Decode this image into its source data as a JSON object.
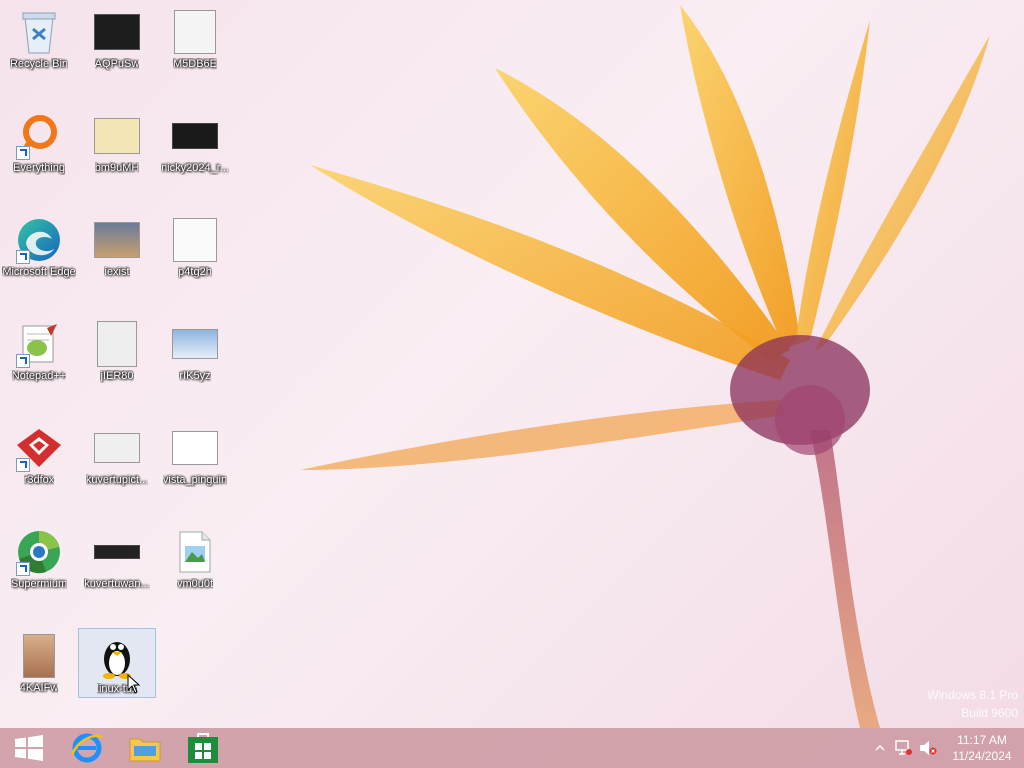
{
  "desktop": {
    "icons": [
      {
        "label": "Recycle Bin",
        "icon": "recycle-bin-icon"
      },
      {
        "label": "AQPuSw",
        "icon": "image-thumbnail"
      },
      {
        "label": "M5DB6E",
        "icon": "image-thumbnail"
      },
      {
        "label": "Everything",
        "icon": "everything-search-icon"
      },
      {
        "label": "bm9uMH",
        "icon": "image-thumbnail"
      },
      {
        "label": "nicky2024_r...",
        "icon": "image-thumbnail"
      },
      {
        "label": "Microsoft Edge",
        "icon": "edge-icon"
      },
      {
        "label": "iexist",
        "icon": "image-thumbnail"
      },
      {
        "label": "p4tg2h",
        "icon": "image-thumbnail"
      },
      {
        "label": "Notepad++",
        "icon": "notepad-plus-plus-icon"
      },
      {
        "label": "jIER80",
        "icon": "image-thumbnail"
      },
      {
        "label": "rIK5yz",
        "icon": "image-thumbnail"
      },
      {
        "label": "r3dfox",
        "icon": "r3dfox-icon"
      },
      {
        "label": "kuvertupict...",
        "icon": "image-thumbnail"
      },
      {
        "label": "vista_pinguin",
        "icon": "image-thumbnail"
      },
      {
        "label": "Supermium",
        "icon": "supermium-icon"
      },
      {
        "label": "kuvertuwan...",
        "icon": "image-thumbnail"
      },
      {
        "label": "vm0u0t",
        "icon": "image-file-icon"
      },
      {
        "label": "4KAIFw",
        "icon": "image-thumbnail"
      },
      {
        "label": "linux-tux",
        "icon": "tux-penguin-icon"
      }
    ]
  },
  "watermark": {
    "line1": "Windows 8.1 Pro",
    "line2": "Build 9600"
  },
  "taskbar": {
    "buttons": [
      "start-button",
      "internet-explorer",
      "file-explorer",
      "windows-store"
    ]
  },
  "clock": {
    "time": "11:17 AM",
    "date": "11/24/2024"
  },
  "colors": {
    "taskbar": "#cd96a0",
    "accent": "#1e90ff",
    "flower": "#f6a623"
  }
}
